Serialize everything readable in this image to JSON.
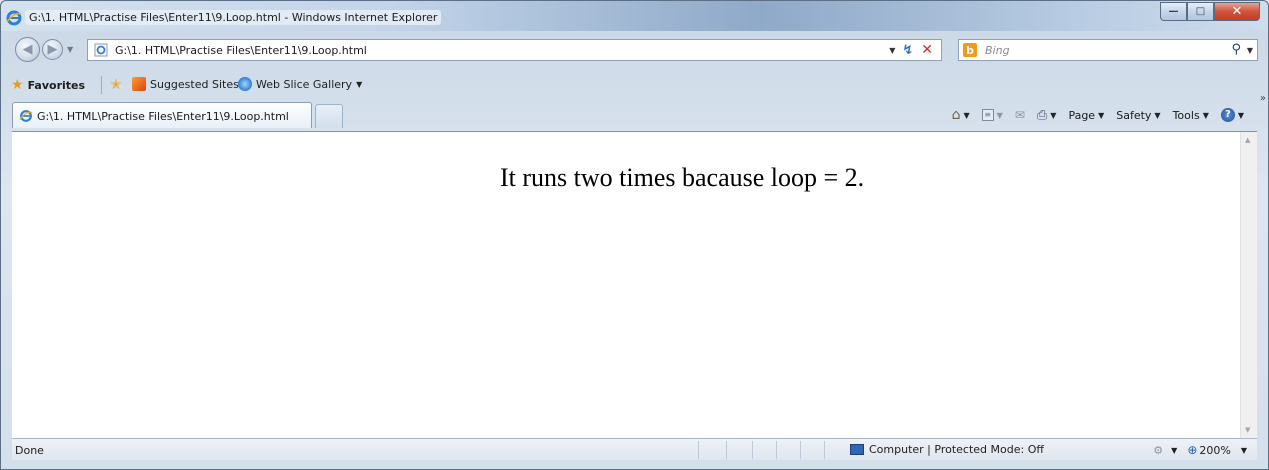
{
  "window": {
    "title": "G:\\1. HTML\\Practise Files\\Enter11\\9.Loop.html - Windows Internet Explorer",
    "minimize": "—",
    "maximize": "□",
    "close": "✕"
  },
  "address": {
    "url": "G:\\1. HTML\\Practise Files\\Enter11\\9.Loop.html"
  },
  "search": {
    "placeholder": "Bing"
  },
  "favorites_bar": {
    "favorites_label": "Favorites",
    "items": [
      {
        "label": "Suggested Sites"
      },
      {
        "label": "Web Slice Gallery"
      }
    ]
  },
  "tabs": [
    {
      "label": "G:\\1. HTML\\Practise Files\\Enter11\\9.Loop.html",
      "active": true
    }
  ],
  "command_bar": {
    "page_label": "Page",
    "safety_label": "Safety",
    "tools_label": "Tools",
    "more": "»"
  },
  "content": {
    "text": "It runs two times bacause loop = 2."
  },
  "status_bar": {
    "status": "Done",
    "zone": "Computer | Protected Mode: Off",
    "zoom": "200%"
  },
  "icons": {
    "browser": "ie-icon",
    "back": "back-arrow-icon",
    "forward": "forward-arrow-icon",
    "compat": "compatibility-view-icon",
    "stop": "stop-icon",
    "search": "magnifier-icon",
    "favorites": "star-icon",
    "home": "home-icon",
    "feeds": "feeds-icon",
    "mail": "mail-icon",
    "print": "printer-icon",
    "help": "help-icon"
  },
  "colors": {
    "stop": "#d02a2a",
    "bing": "#f39a1a",
    "close_button": "#c13c22"
  }
}
